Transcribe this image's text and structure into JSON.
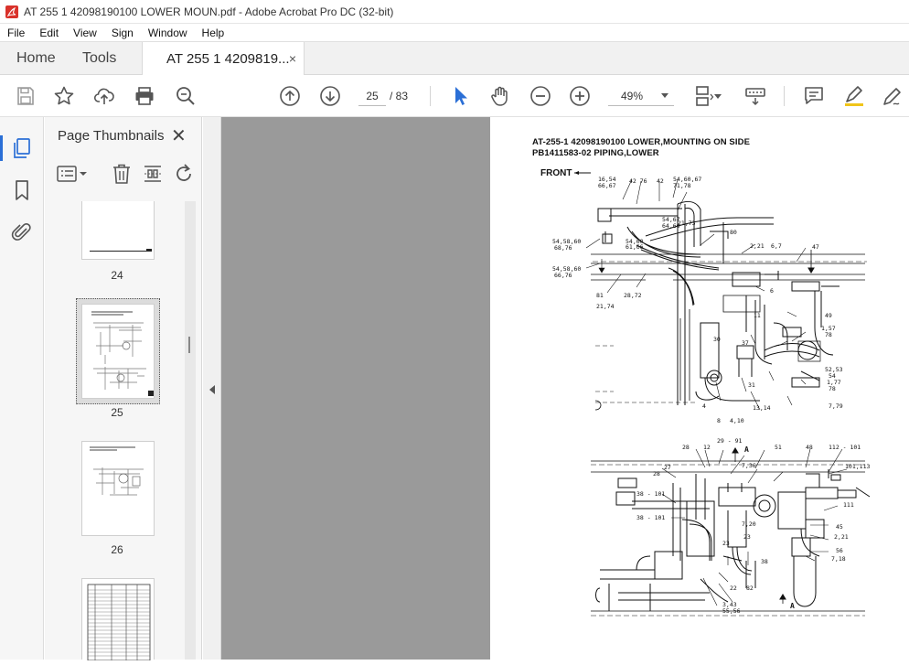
{
  "window": {
    "title": "AT 255 1 42098190100 LOWER MOUN.pdf - Adobe Acrobat Pro DC (32-bit)"
  },
  "menu": [
    "File",
    "Edit",
    "View",
    "Sign",
    "Window",
    "Help"
  ],
  "tabs": {
    "home": "Home",
    "tools": "Tools",
    "document": "AT 255 1 4209819...",
    "close_glyph": "×"
  },
  "toolbar": {
    "current_page": "25",
    "total_pages": "/  83",
    "zoom": "49%"
  },
  "thumbnail_panel": {
    "title": "Page Thumbnails",
    "close_glyph": "✕",
    "pages": [
      {
        "label": "24"
      },
      {
        "label": "25",
        "selected": true
      },
      {
        "label": "26"
      }
    ]
  },
  "document": {
    "heading_line1": "AT-255-1 42098190100 LOWER,MOUNTING ON SIDE",
    "heading_line2": "PB1411583-02 PIPING,LOWER",
    "front_label": "FRONT",
    "callouts_upper": [
      "16,54",
      "66,67",
      "42 76",
      "42",
      "54,60,67",
      "71,78",
      "54,67",
      "64,66",
      "21,73",
      "54,58,60",
      "68,76",
      "54,60",
      "61,66",
      "80",
      "2,21",
      "6,7",
      "47",
      "54,58,60",
      "66,76",
      "81",
      "28,72",
      "21,74",
      "6",
      "11",
      "49",
      "1,57",
      "78",
      "30",
      "37",
      "52,53",
      "54",
      "1,77",
      "78",
      "31",
      "4",
      "13,14",
      "8",
      "4,10",
      "7,79"
    ],
    "callouts_lower": [
      "29 - 91",
      "28",
      "12",
      "A",
      "51",
      "48",
      "112 - 101",
      "27",
      "7,36",
      "101,113",
      "28",
      "38 - 101",
      "111",
      "7,20",
      "23",
      "45",
      "38 - 101",
      "2,21",
      "56",
      "23",
      "7,18",
      "22",
      "82",
      "38",
      "3,43",
      "55,56",
      "A"
    ],
    "brand_accent": "#2b6fd6"
  }
}
